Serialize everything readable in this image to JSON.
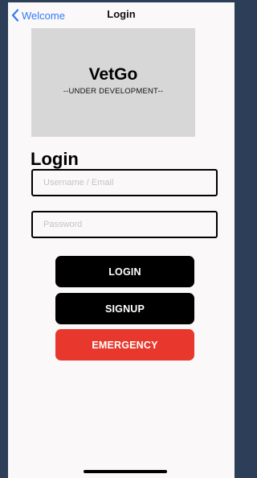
{
  "nav": {
    "back_label": "Welcome",
    "title": "Login"
  },
  "banner": {
    "title": "VetGo",
    "subtitle": "--UNDER DEVELOPMENT--"
  },
  "form": {
    "heading": "Login",
    "username_placeholder": "Username / Email",
    "username_value": "",
    "password_placeholder": "Password",
    "password_value": ""
  },
  "buttons": {
    "login_label": "LOGIN",
    "signup_label": "SIGNUP",
    "emergency_label": "EMERGENCY"
  },
  "colors": {
    "accent": "#2f7cf6",
    "primary_button": "#000000",
    "emergency_button": "#e8382d",
    "banner_bg": "#d7d7d7",
    "screen_bg": "#fbf8f9"
  },
  "icons": {
    "back": "chevron-left-icon"
  }
}
